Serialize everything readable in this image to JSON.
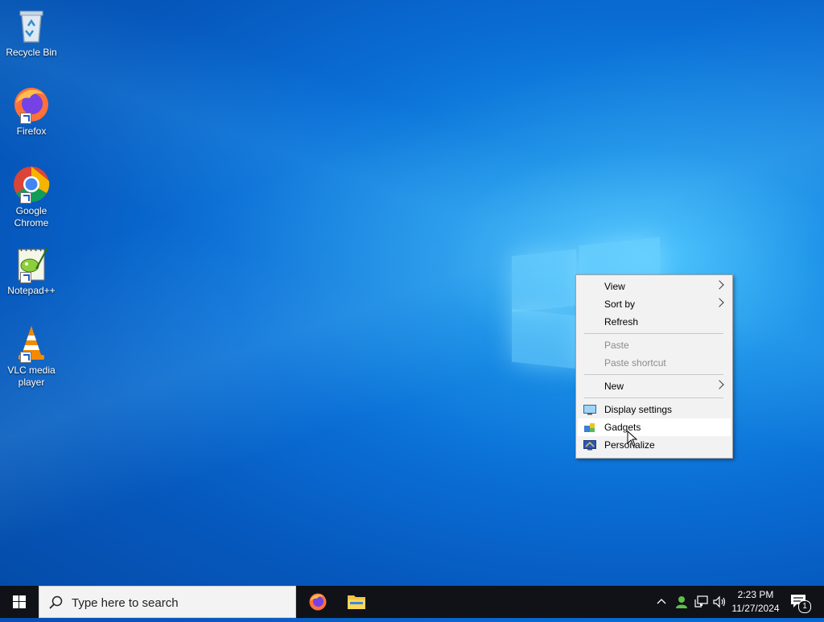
{
  "desktop": {
    "icons": [
      {
        "label": "Recycle Bin"
      },
      {
        "label": "Firefox"
      },
      {
        "label": "Google Chrome"
      },
      {
        "label": "Notepad++"
      },
      {
        "label": "VLC media player"
      }
    ]
  },
  "context_menu": {
    "items": [
      {
        "label": "View",
        "submenu": true,
        "enabled": true
      },
      {
        "label": "Sort by",
        "submenu": true,
        "enabled": true
      },
      {
        "label": "Refresh",
        "enabled": true
      },
      {
        "label": "Paste",
        "enabled": false
      },
      {
        "label": "Paste shortcut",
        "enabled": false
      },
      {
        "label": "New",
        "submenu": true,
        "enabled": true
      },
      {
        "label": "Display settings",
        "icon": "display-icon",
        "enabled": true
      },
      {
        "label": "Gadgets",
        "icon": "gadgets-icon",
        "enabled": true,
        "highlighted": true
      },
      {
        "label": "Personalize",
        "icon": "personalize-icon",
        "enabled": true
      }
    ]
  },
  "taskbar": {
    "search_placeholder": "Type here to search",
    "pinned": [
      {
        "name": "firefox-icon"
      },
      {
        "name": "file-explorer-icon"
      }
    ],
    "clock": {
      "time": "2:23 PM",
      "date": "11/27/2024"
    },
    "notification_count": "1"
  },
  "colors": {
    "taskbar": "#101218",
    "menu_bg": "#f2f2f2",
    "menu_highlight": "#ffffff",
    "wallpaper_accent": "#0a6fd6"
  }
}
